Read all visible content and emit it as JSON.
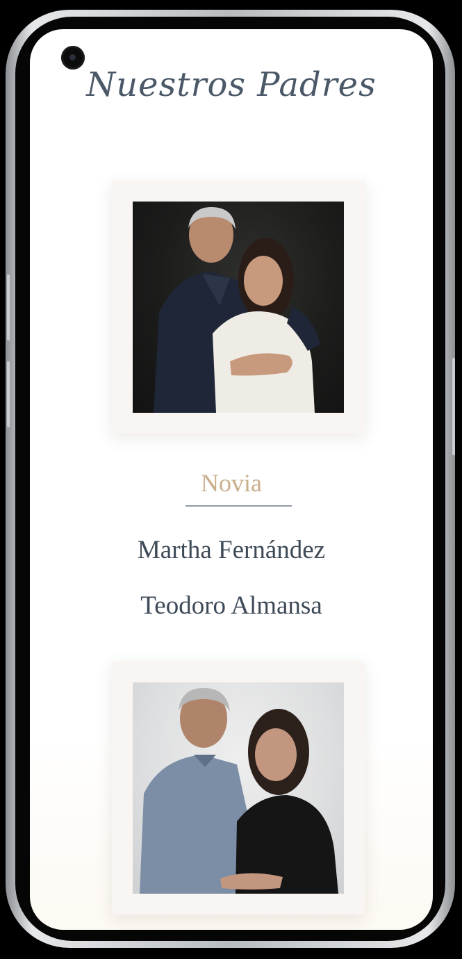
{
  "page": {
    "section_title": "Nuestros Padres"
  },
  "bride_parents": {
    "role_label": "Novia",
    "names": [
      "Martha Fernández",
      "Teodoro Almansa"
    ]
  },
  "colors": {
    "title": "#4a5867",
    "role_label": "#c9ae8c",
    "names": "#3e4a57",
    "card_background": "#f8f5f2",
    "underline": "#8e9aa6"
  },
  "icons": {
    "camera": "front-camera-icon"
  }
}
